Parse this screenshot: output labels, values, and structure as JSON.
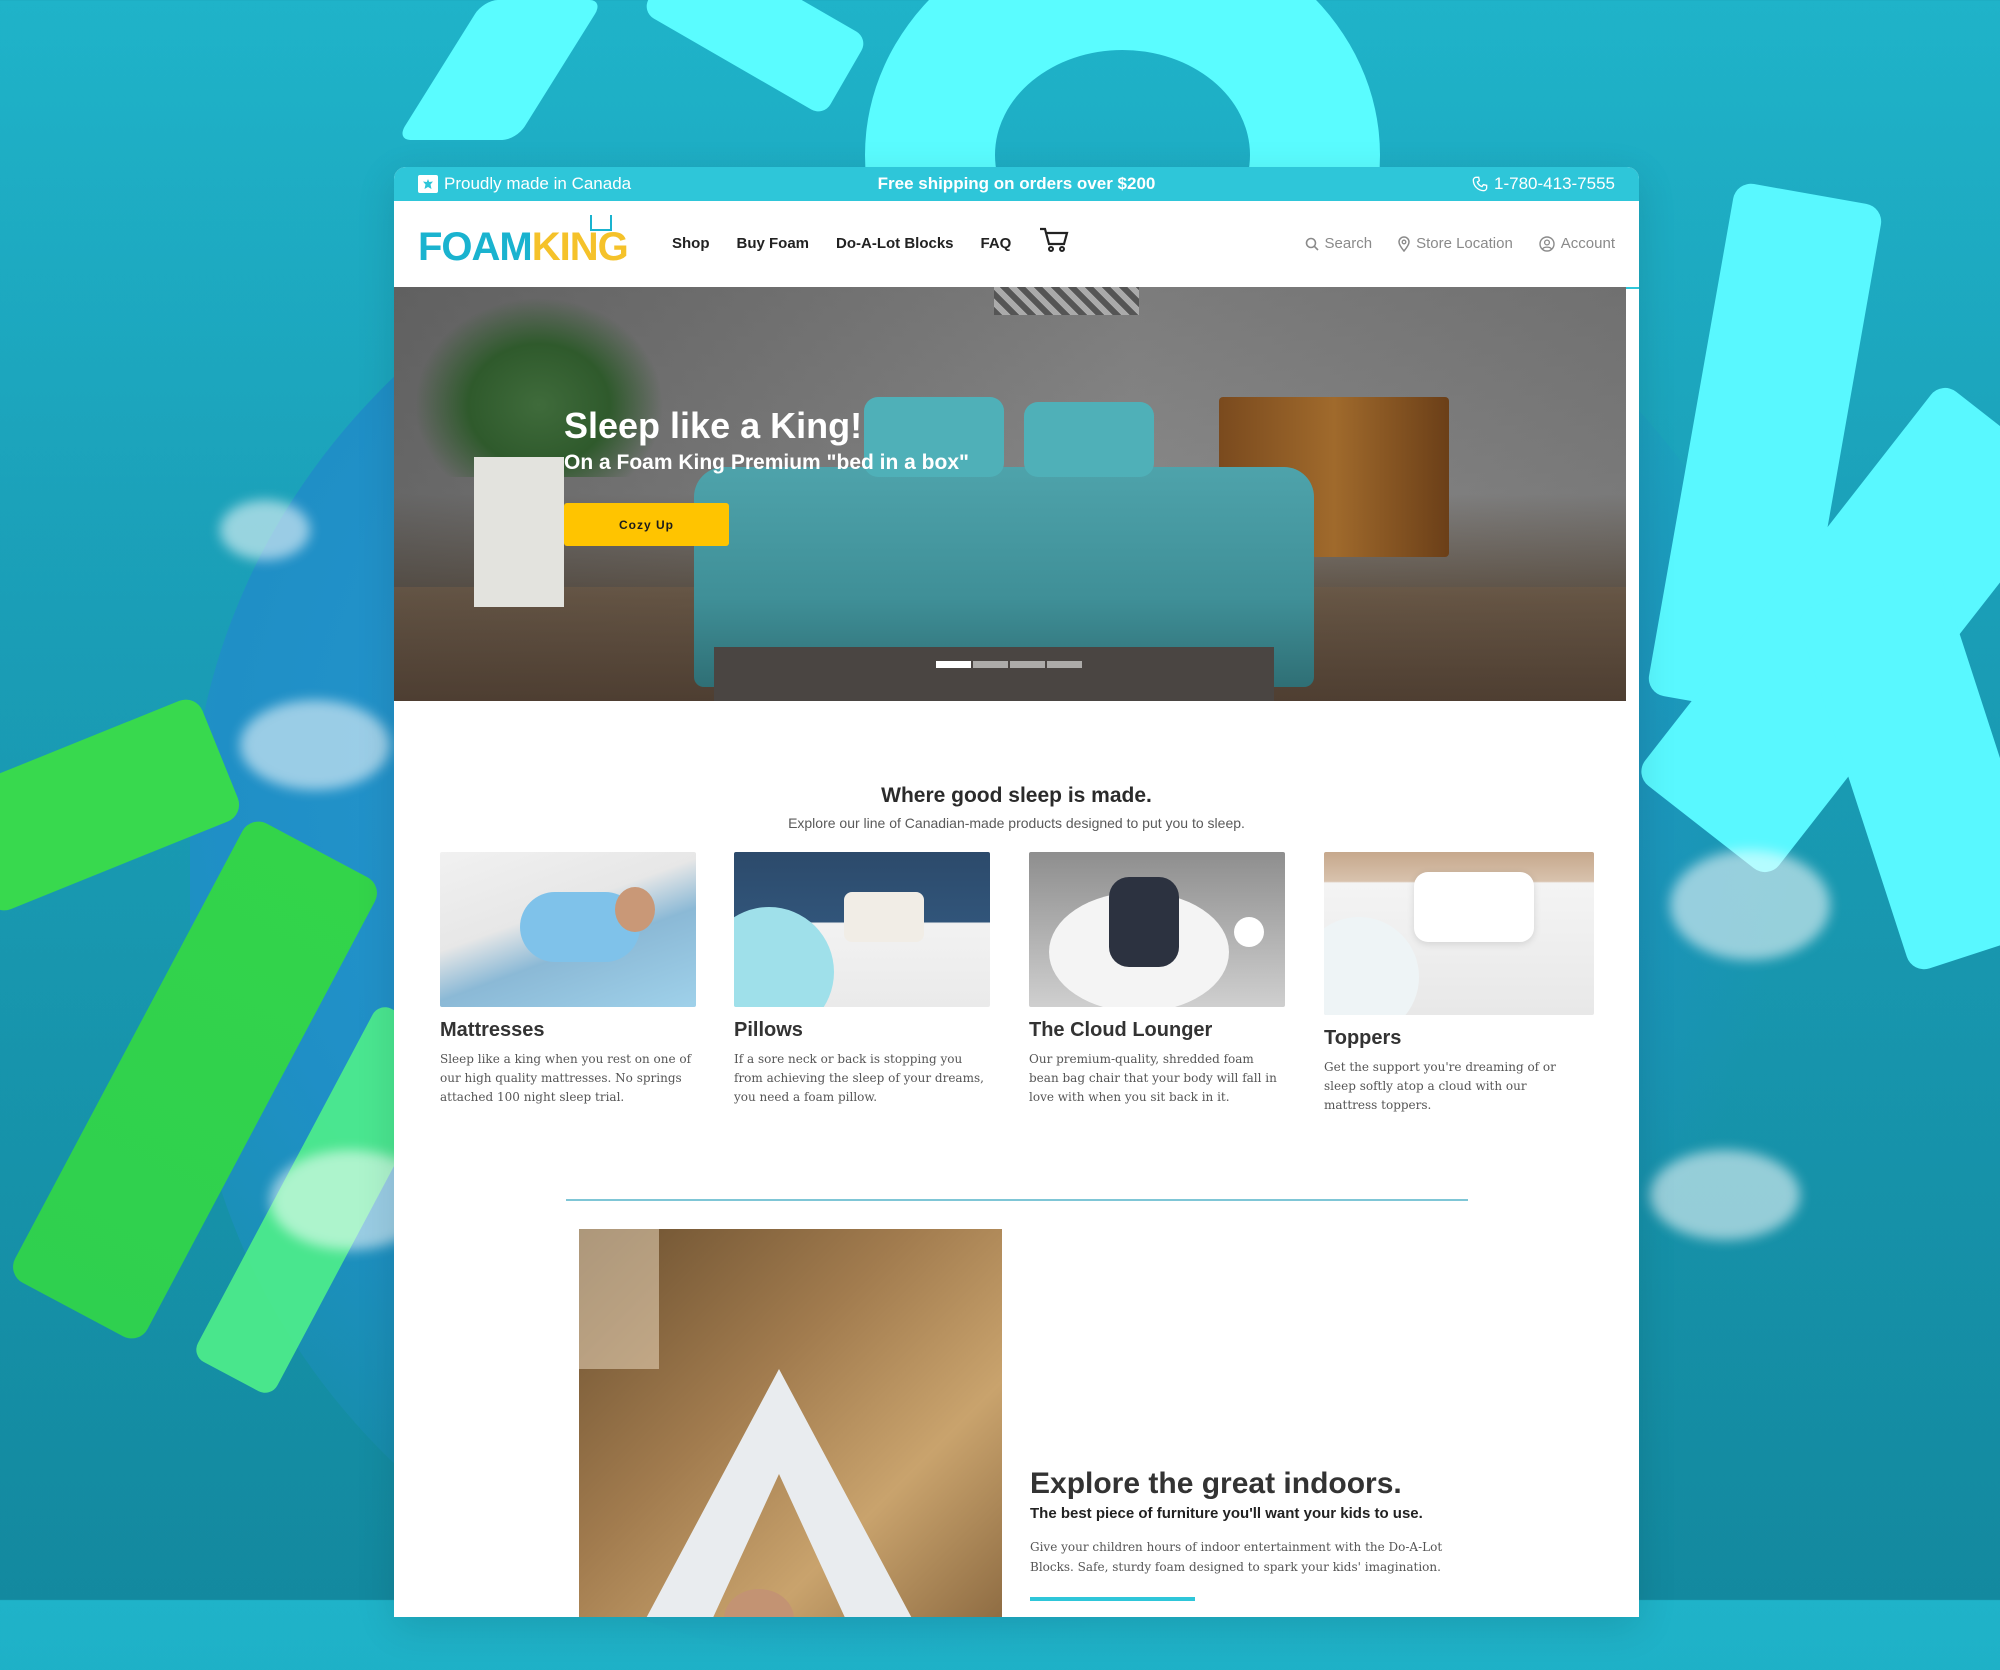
{
  "colors": {
    "accent": "#2ec6d9",
    "brand_yellow": "#f5c22a",
    "cta_yellow": "#ffc400",
    "text_dark": "#2b2b2b"
  },
  "topbar": {
    "left_icon": "canada-flag-icon",
    "left_text": "Proudly made in Canada",
    "center_text": "Free shipping on orders over $200",
    "phone_icon": "phone-icon",
    "phone": "1-780-413-7555"
  },
  "nav": {
    "logo_foam": "FOAM",
    "logo_king": "KING",
    "menu": [
      "Shop",
      "Buy Foam",
      "Do-A-Lot Blocks",
      "FAQ"
    ],
    "cart_icon": "cart-icon",
    "search_label": "Search",
    "store_label": "Store Location",
    "account_label": "Account"
  },
  "hero": {
    "title": "Sleep like a King!",
    "subtitle": "On a Foam King Premium \"bed in a box\"",
    "cta": "Cozy Up",
    "slides": 4,
    "active_slide": 1
  },
  "products_section": {
    "title": "Where good sleep is made.",
    "subtitle": "Explore our line of Canadian-made products designed to put you to sleep."
  },
  "products": [
    {
      "name": "Mattresses",
      "desc": "Sleep like a king when you rest on one of our high quality mattresses. No springs attached 100 night sleep trial."
    },
    {
      "name": "Pillows",
      "desc": "If a sore neck or back is stopping you from achieving the sleep of your dreams, you need a foam pillow."
    },
    {
      "name": "The Cloud Lounger",
      "desc": "Our premium-quality, shredded foam bean bag chair that your body will fall in love with when you sit back in it."
    },
    {
      "name": "Toppers",
      "desc": "Get the support you're dreaming of or sleep softly atop a cloud with our mattress toppers."
    }
  ],
  "feature": {
    "title": "Explore the great indoors.",
    "subtitle": "The best piece of furniture you'll want your kids to use.",
    "body": "Give your children hours of indoor entertainment with the Do-A-Lot Blocks. Safe, sturdy foam designed to spark your kids' imagination."
  }
}
